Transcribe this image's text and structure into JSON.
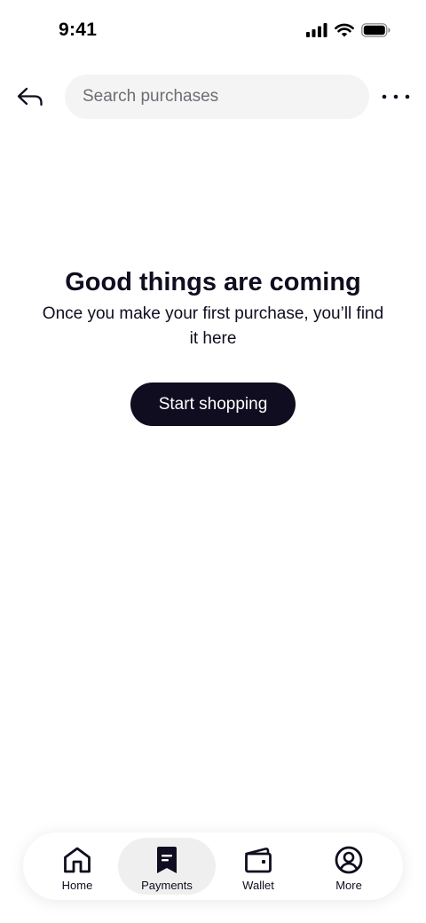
{
  "status_bar": {
    "time": "9:41",
    "icons": [
      "signal-icon",
      "wifi-icon",
      "battery-icon"
    ]
  },
  "header": {
    "back_icon": "back-arrow-icon",
    "search_placeholder": "Search purchases",
    "search_value": "",
    "more_icon": "more-dots-icon"
  },
  "empty_state": {
    "title": "Good things are coming",
    "body": "Once you make your first purchase, you’ll find it here",
    "button_label": "Start shopping"
  },
  "nav": {
    "active": "Payments",
    "items": [
      {
        "label": "Home",
        "icon": "home-icon"
      },
      {
        "label": "Payments",
        "icon": "receipt-icon"
      },
      {
        "label": "Wallet",
        "icon": "wallet-icon"
      },
      {
        "label": "More",
        "icon": "profile-icon"
      }
    ]
  },
  "colors": {
    "primary": "#0f0d1f",
    "search_bg": "#f4f4f5",
    "active_tab_bg": "#efefef",
    "background": "#ffffff"
  }
}
